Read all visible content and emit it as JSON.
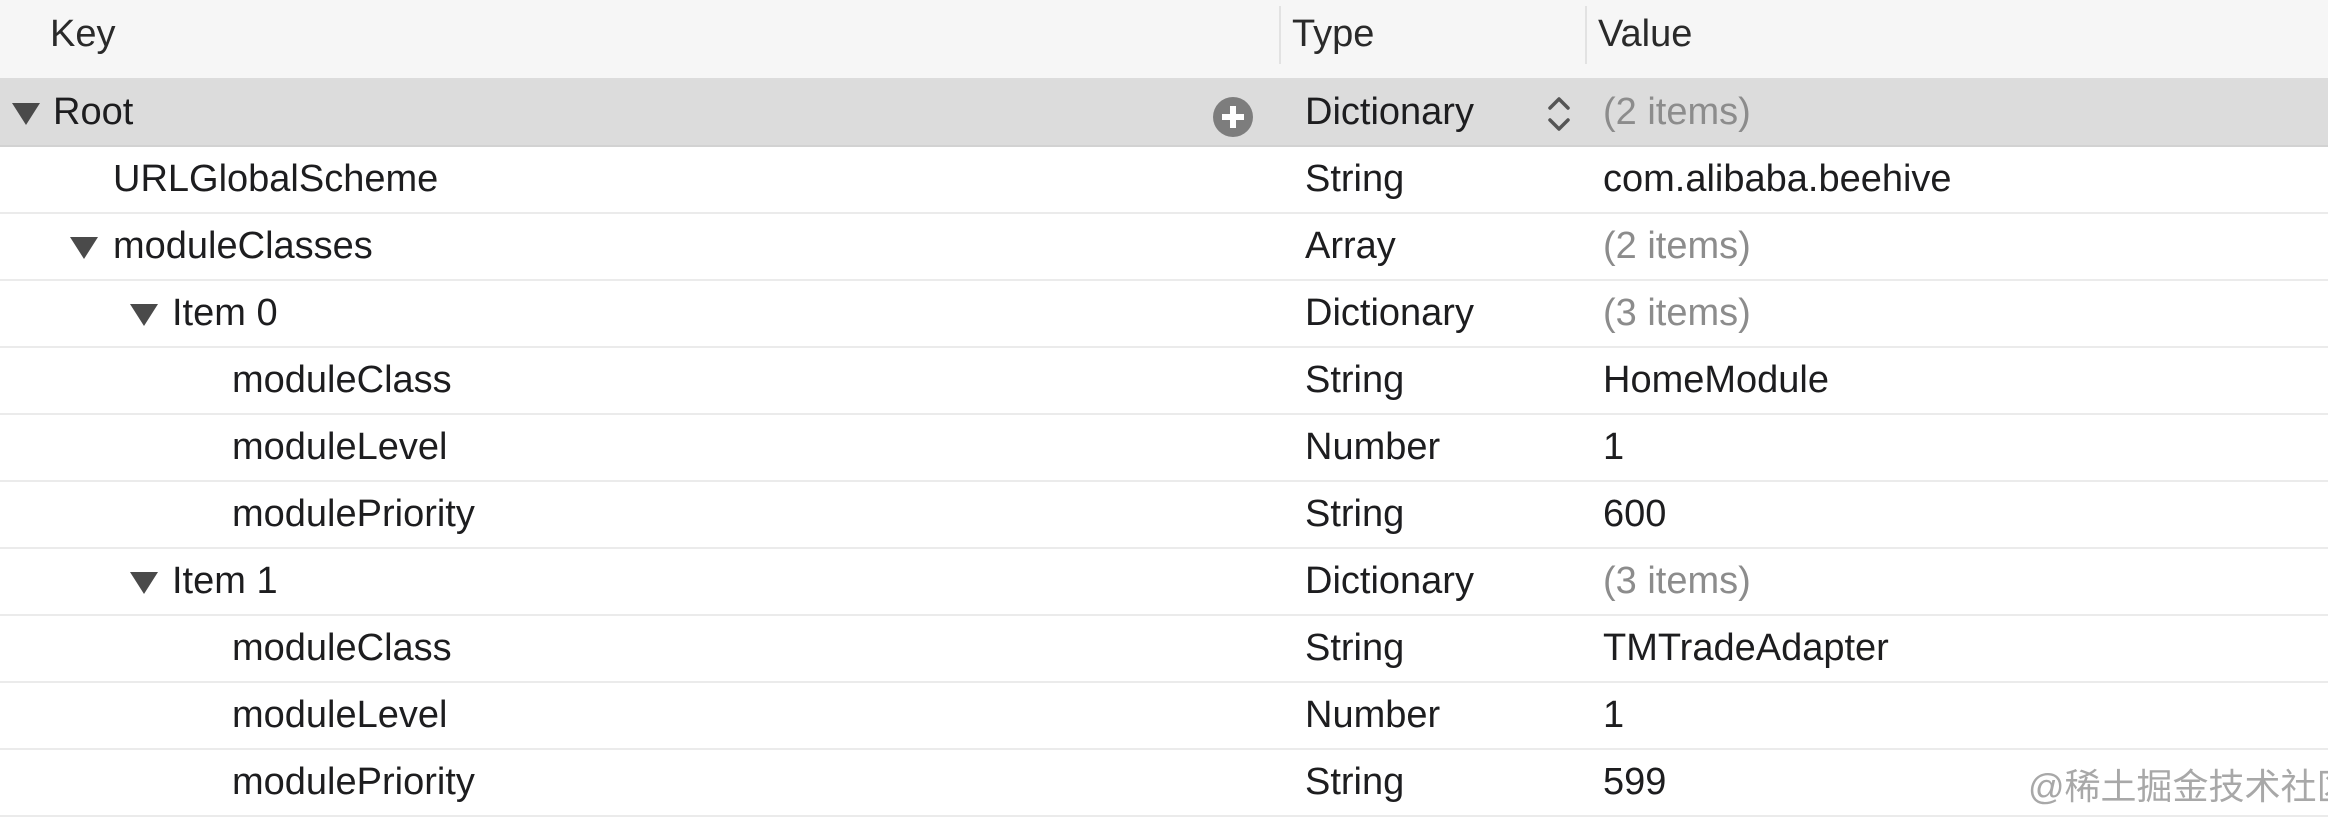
{
  "columns": {
    "key": "Key",
    "type": "Type",
    "value": "Value"
  },
  "rows": [
    {
      "key": "Root",
      "type": "Dictionary",
      "value": "(2 items)"
    },
    {
      "key": "URLGlobalScheme",
      "type": "String",
      "value": "com.alibaba.beehive"
    },
    {
      "key": "moduleClasses",
      "type": "Array",
      "value": "(2 items)"
    },
    {
      "key": "Item 0",
      "type": "Dictionary",
      "value": "(3 items)"
    },
    {
      "key": "moduleClass",
      "type": "String",
      "value": "HomeModule"
    },
    {
      "key": "moduleLevel",
      "type": "Number",
      "value": "1"
    },
    {
      "key": "modulePriority",
      "type": "String",
      "value": "600"
    },
    {
      "key": "Item 1",
      "type": "Dictionary",
      "value": "(3 items)"
    },
    {
      "key": "moduleClass",
      "type": "String",
      "value": "TMTradeAdapter"
    },
    {
      "key": "moduleLevel",
      "type": "Number",
      "value": "1"
    },
    {
      "key": "modulePriority",
      "type": "String",
      "value": "599"
    }
  ],
  "watermark": "@稀土掘金技术社区",
  "icons": {
    "add": "plus-circle-icon",
    "stepper": "up-down-stepper-icon",
    "disclosure": "disclosure-triangle-icon"
  },
  "colors": {
    "selected_row": "#dcdcdc",
    "muted_text": "#8c8c8c",
    "header_bg": "#f6f6f6"
  }
}
